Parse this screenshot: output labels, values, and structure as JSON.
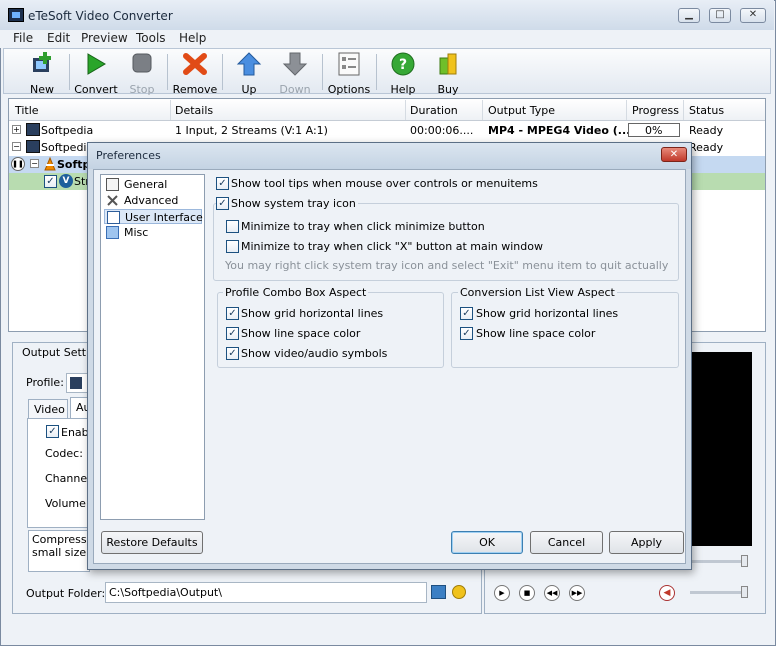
{
  "app": {
    "title": "eTeSoft Video Converter"
  },
  "menu": [
    "File",
    "Edit",
    "Preview",
    "Tools",
    "Help"
  ],
  "toolbar": {
    "new": "New",
    "convert": "Convert",
    "stop": "Stop",
    "remove": "Remove",
    "up": "Up",
    "down": "Down",
    "options": "Options",
    "help": "Help",
    "buy": "Buy"
  },
  "list": {
    "columns": [
      "Title",
      "Details",
      "Duration",
      "Output Type",
      "Progress",
      "Status"
    ],
    "rows": [
      {
        "title": "Softpedia",
        "details": "1 Input, 2 Streams (V:1 A:1)",
        "duration": "00:00:06....",
        "output": "MP4 - MPEG4 Video (...",
        "progress": "0%",
        "status": "Ready"
      },
      {
        "title": "Softpedia",
        "status": "Ready"
      },
      {
        "title": "Softp"
      },
      {
        "title": "Str"
      }
    ]
  },
  "settings": {
    "frame_title": "Output Settin",
    "profile_label": "Profile:",
    "tab_video": "Video",
    "tab_audio": "Au",
    "enable_label": "Enab",
    "codec_label": "Codec:",
    "channels_label": "Channels",
    "volume_label": "Volume:",
    "compress_line1": "Compressio",
    "compress_line2": "small size an",
    "output_folder_label": "Output Folder:",
    "output_folder_value": "C:\\Softpedia\\Output\\"
  },
  "dialog": {
    "title": "Preferences",
    "nav": [
      "General",
      "Advanced",
      "User Interface",
      "Misc"
    ],
    "selected_nav": "User Interface",
    "opt_tooltips": "Show tool tips when mouse over controls or menuitems",
    "opt_tray": "Show system tray icon",
    "opt_min_tray": "Minimize to tray when click minimize button",
    "opt_close_tray": "Minimize to tray when click \"X\" button at main window",
    "tray_hint": "You may right click system tray icon and select \"Exit\" menu item to quit actually",
    "profile_group": "Profile Combo Box Aspect",
    "profile_grid": "Show grid horizontal lines",
    "profile_linecolor": "Show line space color",
    "profile_symbols": "Show video/audio symbols",
    "conv_group": "Conversion List View Aspect",
    "conv_grid": "Show grid horizontal lines",
    "conv_linecolor": "Show line space color",
    "restore": "Restore Defaults",
    "ok": "OK",
    "cancel": "Cancel",
    "apply": "Apply"
  },
  "colors": {
    "accent": "#3c7fb1",
    "selected_row": "#c5d9f1",
    "selected_child": "#b8dcb0",
    "preview_bg": "#000000"
  }
}
